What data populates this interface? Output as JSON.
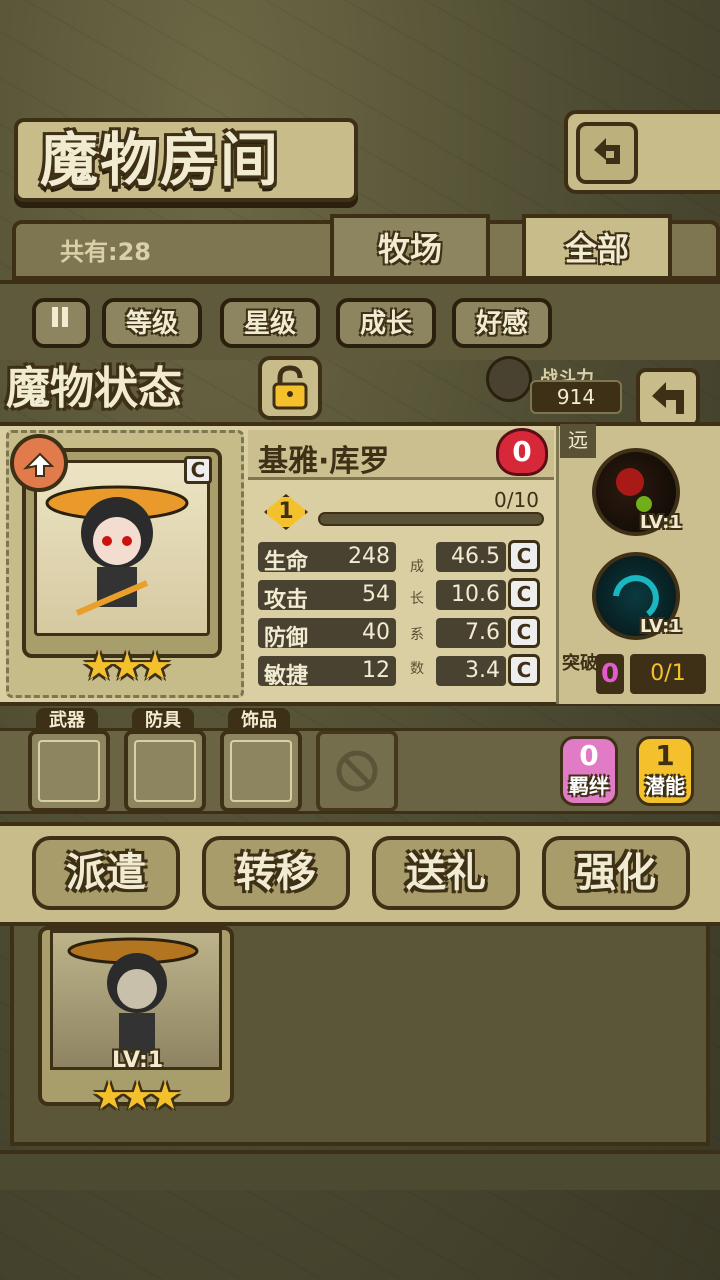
{
  "header": {
    "title": "魔物房间"
  },
  "summary": {
    "count_label": "共有:28"
  },
  "tabs": [
    {
      "label": "牧场",
      "active": false
    },
    {
      "label": "全部",
      "active": true
    }
  ],
  "sort_buttons": [
    "等级",
    "星级",
    "成长",
    "好感"
  ],
  "status_panel": {
    "title": "魔物状态",
    "power_label": "战斗力",
    "power_value": "914"
  },
  "monster": {
    "name": "基雅·库罗",
    "heart_value": "0",
    "rank": "C",
    "stars": "★★★",
    "level": "1",
    "exp": "0/10",
    "exp_fraction": 0,
    "stats": [
      {
        "name": "生命",
        "value": "248",
        "growth": "46.5",
        "grade": "C"
      },
      {
        "name": "攻击",
        "value": "54",
        "growth": "10.6",
        "grade": "C"
      },
      {
        "name": "防御",
        "value": "40",
        "growth": "7.6",
        "grade": "C"
      },
      {
        "name": "敏捷",
        "value": "12",
        "growth": "3.4",
        "grade": "C"
      }
    ],
    "growth_label_chars": [
      "成",
      "长",
      "系",
      "数"
    ]
  },
  "skills": {
    "range_tag": "远",
    "items": [
      {
        "level": "LV:1",
        "color": "#c01a1a"
      },
      {
        "level": "LV:1",
        "color": "#1bb7c0"
      }
    ],
    "breakthrough_label": "突破",
    "breakthrough_count": "0",
    "breakthrough_progress": "0/1"
  },
  "equipment": {
    "slots": [
      {
        "label": "武器"
      },
      {
        "label": "防具"
      },
      {
        "label": "饰品"
      }
    ],
    "bond": {
      "count": "0",
      "label": "羁绊"
    },
    "potential": {
      "count": "1",
      "label": "潜能"
    }
  },
  "actions": [
    "派遣",
    "转移",
    "送礼",
    "强化"
  ],
  "list": {
    "card_level": "LV:1",
    "card_stars": "★★★"
  }
}
